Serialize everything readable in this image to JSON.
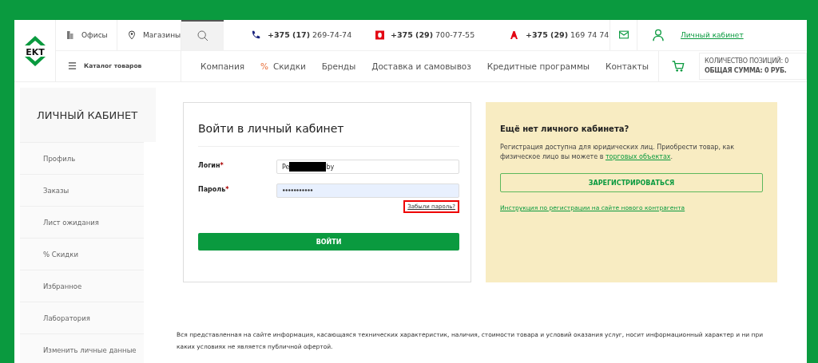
{
  "header": {
    "logo": "EKT",
    "links": [
      {
        "kind": "offices",
        "label": "Офисы"
      },
      {
        "kind": "shops",
        "label": "Магазины"
      }
    ],
    "phones": [
      {
        "kind": "city",
        "code": "+375 (17)",
        "number": "269-74-74"
      },
      {
        "kind": "mts",
        "code": "+375 (29)",
        "number": "700-77-55"
      },
      {
        "kind": "a1",
        "code": "+375 (29)",
        "number": "169 74 74"
      }
    ],
    "account_link": "Личный кабинет",
    "catalog": "Каталог товаров",
    "nav": [
      {
        "label": "Компания",
        "kind": "plain"
      },
      {
        "label": "Скидки",
        "kind": "discount",
        "prefix": "%"
      },
      {
        "label": "Бренды",
        "kind": "plain"
      },
      {
        "label": "Доставка и самовывоз",
        "kind": "plain"
      },
      {
        "label": "Кредитные программы",
        "kind": "plain"
      },
      {
        "label": "Контакты",
        "kind": "plain"
      }
    ],
    "cart": {
      "count": "КОЛИЧЕСТВО ПОЗИЦИЙ: 0",
      "total": "ОБЩАЯ СУММА: 0 РУБ."
    }
  },
  "sidebar": {
    "title": "ЛИЧНЫЙ КАБИНЕТ",
    "items": [
      "Профиль",
      "Заказы",
      "Лист ожидания",
      "% Скидки",
      "Избранное",
      "Лаборатория",
      "Изменить личные данные"
    ]
  },
  "login": {
    "title": "Войти в личный кабинет",
    "fields": [
      {
        "label": "Логин",
        "required": "*",
        "kind": "text",
        "value_start": "Pe",
        "value_end": "by",
        "redacted": true,
        "autofilled": false
      },
      {
        "label": "Пароль",
        "required": "*",
        "kind": "password",
        "value_start": "•••••••••••",
        "autofilled": true
      }
    ],
    "forgot": {
      "label": "Забыли пароль?",
      "highlighted": true
    },
    "submit": "ВОЙТИ"
  },
  "register": {
    "title": "Ещё нет личного кабинета?",
    "text": "Регистрация доступна для юридических лиц. Приобрести товар, как физическое лицо вы можете в",
    "link": "торговых объектах",
    "after": ".",
    "button": "ЗАРЕГИСТРИРОВАТЬСЯ",
    "instruction": "Инструкция по регистрации на сайте нового контрагента"
  },
  "footer": "Вся представленная на сайте информация, касающаяся технических характеристик, наличия, стоимости товара и условий оказания услуг, носит информационный характер и ни при каких условиях не является публичной офертой."
}
